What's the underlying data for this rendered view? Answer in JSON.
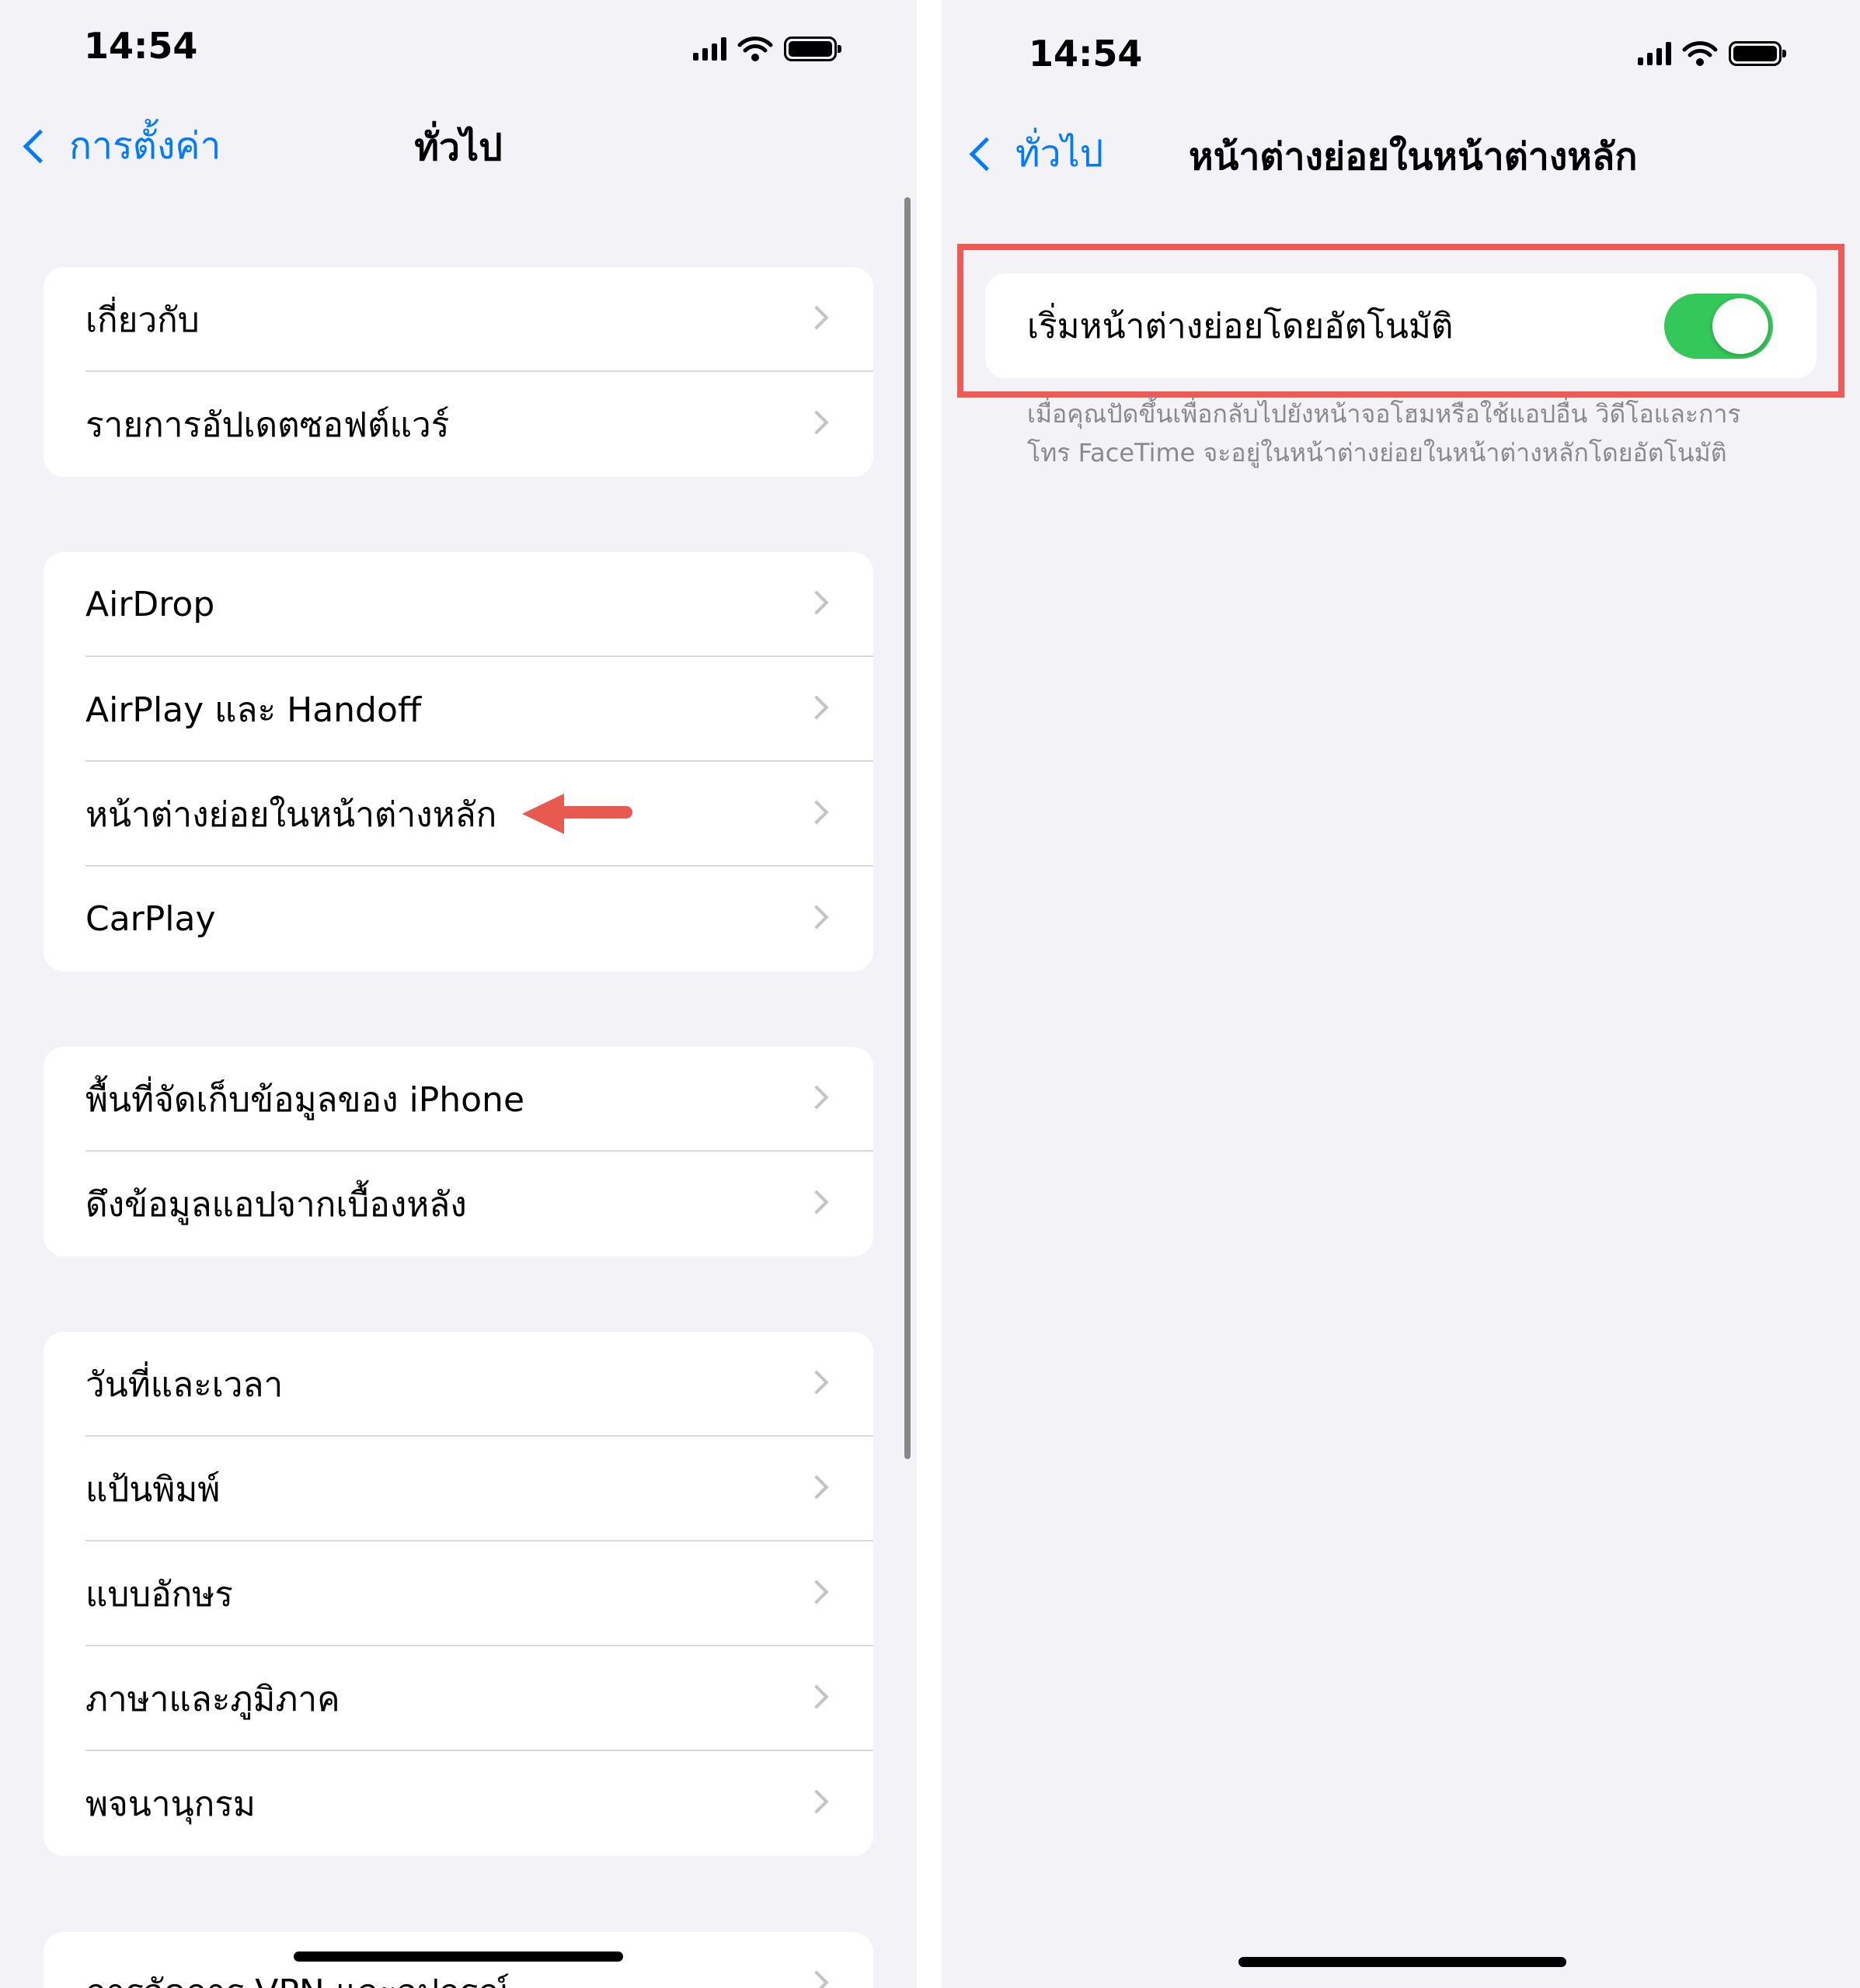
{
  "left_screen": {
    "status_bar": {
      "time": "14:54"
    },
    "nav": {
      "back_label": "การตั้งค่า",
      "title": "ทั่วไป"
    },
    "groups": [
      {
        "items": [
          "เกี่ยวกับ",
          "รายการอัปเดตซอฟต์แวร์"
        ]
      },
      {
        "items": [
          "AirDrop",
          "AirPlay และ Handoff",
          "หน้าต่างย่อยในหน้าต่างหลัก",
          "CarPlay"
        ]
      },
      {
        "items": [
          "พื้นที่จัดเก็บข้อมูลของ iPhone",
          "ดึงข้อมูลแอปจากเบื้องหลัง"
        ]
      },
      {
        "items": [
          "วันที่และเวลา",
          "แป้นพิมพ์",
          "แบบอักษร",
          "ภาษาและภูมิภาค",
          "พจนานุกรม"
        ]
      },
      {
        "items": [
          "การจัดการ VPN และอุปกรณ์"
        ]
      }
    ]
  },
  "right_screen": {
    "status_bar": {
      "time": "14:54"
    },
    "nav": {
      "back_label": "ทั่วไป",
      "title": "หน้าต่างย่อยในหน้าต่างหลัก"
    },
    "setting": {
      "label": "เริ่มหน้าต่างย่อยโดยอัตโนมัติ",
      "enabled": true,
      "footnote": "เมื่อคุณปัดขึ้นเพื่อกลับไปยังหน้าจอโฮมหรือใช้แอปอื่น วิดีโอและการโทร FaceTime จะอยู่ในหน้าต่างย่อยในหน้าต่างหลักโดยอัตโนมัติ"
    }
  },
  "colors": {
    "accent": "#007aff",
    "toggle_on": "#34c759",
    "annotation": "#ef5a55",
    "background": "#f2f2f7"
  }
}
